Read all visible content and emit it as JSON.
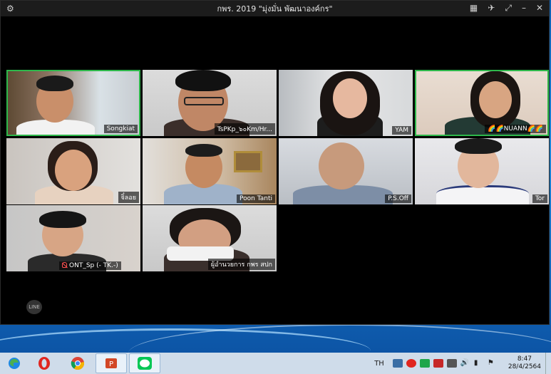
{
  "window": {
    "title": "กพร. 2019 \"มุ่งมั่น พัฒนาองค์กร\""
  },
  "participants": [
    {
      "name": "Songkiat",
      "active": true
    },
    {
      "name": "TsPKp_๖๐Km/Hr...",
      "active": false
    },
    {
      "name": "YAM",
      "active": false
    },
    {
      "name": "🌈🌈NUANN🌈🌈",
      "active": true
    },
    {
      "name": "จิ๋ลอย",
      "active": false
    },
    {
      "name": "Poon Tanti",
      "active": false
    },
    {
      "name": "P.S.Off",
      "active": false
    },
    {
      "name": "Tor",
      "active": false
    },
    {
      "name": "ONT_Sp (- TK.-)",
      "active": false,
      "muted": true
    },
    {
      "name": "ผู้อำนวยการ กพร สปก",
      "active": false
    }
  ],
  "taskbar": {
    "apps": [
      "edge-icon",
      "opera-icon",
      "chrome-icon",
      "powerpoint-icon",
      "line-icon"
    ],
    "language": "TH",
    "time": "8:47",
    "date": "28/4/2564"
  },
  "colors": {
    "active_speaker": "#2eb84b",
    "titlebar": "#1c1c1c",
    "taskbar": "#cfdcea"
  }
}
